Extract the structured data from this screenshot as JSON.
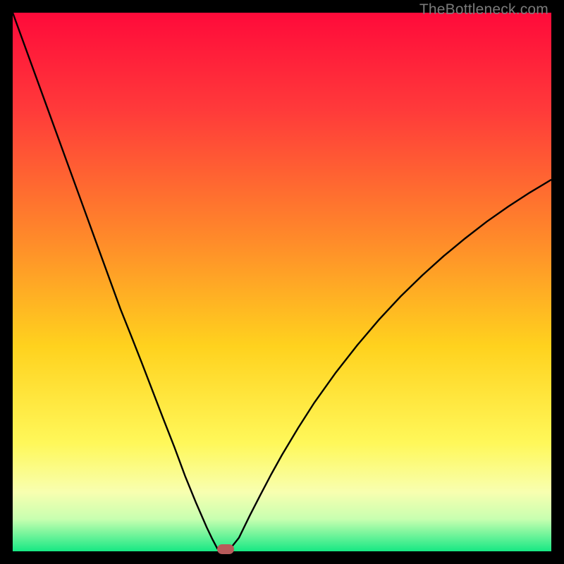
{
  "watermark": "TheBottleneck.com",
  "colors": {
    "gradient_stops": [
      {
        "offset": 0.0,
        "color": "#ff0a3a"
      },
      {
        "offset": 0.18,
        "color": "#ff3a3a"
      },
      {
        "offset": 0.42,
        "color": "#ff8a2a"
      },
      {
        "offset": 0.62,
        "color": "#ffd21e"
      },
      {
        "offset": 0.8,
        "color": "#fff85a"
      },
      {
        "offset": 0.89,
        "color": "#f8ffb0"
      },
      {
        "offset": 0.94,
        "color": "#c8ffb0"
      },
      {
        "offset": 1.0,
        "color": "#17e884"
      }
    ],
    "curve": "#000000",
    "marker": "#b85a5a",
    "background": "#000000"
  },
  "chart_data": {
    "type": "line",
    "title": "",
    "xlabel": "",
    "ylabel": "",
    "xlim": [
      0,
      100
    ],
    "ylim": [
      0,
      100
    ],
    "annotations": [
      "TheBottleneck.com"
    ],
    "x": [
      0,
      2,
      4,
      6,
      8,
      10,
      12,
      14,
      16,
      18,
      20,
      22,
      24,
      26,
      28,
      30,
      32,
      34,
      36,
      37,
      38,
      39,
      40,
      42,
      44,
      46,
      48,
      50,
      53,
      56,
      60,
      64,
      68,
      72,
      76,
      80,
      84,
      88,
      92,
      96,
      100
    ],
    "values": [
      100,
      94.5,
      89,
      83.5,
      78,
      72.5,
      67,
      61.5,
      56,
      50.5,
      45,
      40,
      34.9,
      29.7,
      24.5,
      19.4,
      14,
      9.1,
      4.5,
      2.4,
      0.5,
      0,
      0,
      2.5,
      6.6,
      10.5,
      14.3,
      17.9,
      22.9,
      27.6,
      33.2,
      38.3,
      43,
      47.3,
      51.2,
      54.8,
      58.1,
      61.2,
      64,
      66.6,
      69
    ],
    "marker": {
      "x": 39.5,
      "y": 0.4
    }
  }
}
